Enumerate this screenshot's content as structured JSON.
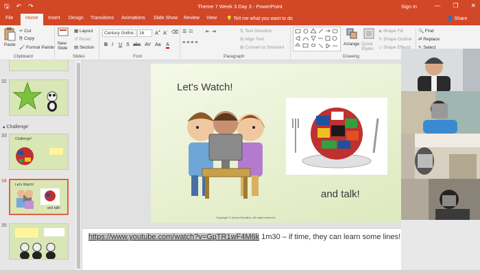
{
  "window": {
    "title": "Theme 7 Week 3 Day 3 - PowerPoint",
    "sign_in": "Sign in",
    "minimize": "—",
    "restore": "❐",
    "close": "✕"
  },
  "qat": {
    "save": "🖫",
    "undo": "↶",
    "redo": "↷"
  },
  "tabs": [
    {
      "label": "File"
    },
    {
      "label": "Home",
      "active": true
    },
    {
      "label": "Insert"
    },
    {
      "label": "Design"
    },
    {
      "label": "Transitions"
    },
    {
      "label": "Animations"
    },
    {
      "label": "Slide Show"
    },
    {
      "label": "Review"
    },
    {
      "label": "View"
    }
  ],
  "tell_me": "Tell me what you want to do",
  "share": "Share",
  "ribbon": {
    "clipboard": {
      "paste": "Paste",
      "cut": "Cut",
      "copy": "Copy",
      "format_painter": "Format Painter",
      "group": "Clipboard"
    },
    "slides": {
      "new_slide": "New Slide",
      "layout": "Layout",
      "reset": "Reset",
      "section": "Section",
      "group": "Slides"
    },
    "font": {
      "name": "Century Gothic",
      "size": "16",
      "bold": "B",
      "italic": "I",
      "underline": "U",
      "strike": "S",
      "shadow": "abc",
      "spacing": "AV",
      "case": "Aa",
      "color": "A",
      "group": "Font"
    },
    "paragraph": {
      "text_direction": "Text Direction",
      "align_text": "Align Text",
      "smartart": "Convert to SmartArt",
      "group": "Paragraph"
    },
    "drawing": {
      "arrange": "Arrange",
      "quick_styles": "Quick Styles",
      "shape_fill": "Shape Fill",
      "shape_outline": "Shape Outline",
      "shape_effects": "Shape Effects",
      "group": "Drawing"
    },
    "editing": {
      "find": "Find",
      "replace": "Replace",
      "select": "Select"
    }
  },
  "slides_panel": {
    "s32": "32",
    "section_challenge": "Challenge",
    "s33": "33",
    "s33_text": "Challenge!",
    "s34": "34",
    "s34_title": "Let's Watch!",
    "s34_sub": "and talk!",
    "s35": "35",
    "star": "★"
  },
  "slide": {
    "title": "Let's Watch!",
    "subtitle": "and talk!",
    "copyright": "Copyright © Janus Education. All rights reserved."
  },
  "notes": {
    "link": "https://www.youtube.com/watch?v=GpTR1wF4M6k",
    "text": " 1m30 – if time, they can learn some lines!"
  }
}
